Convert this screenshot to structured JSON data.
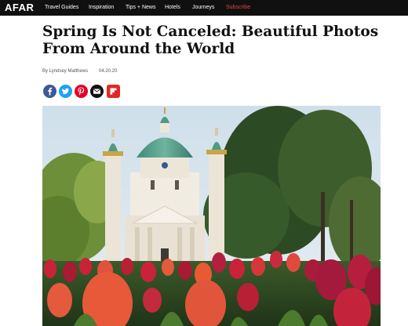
{
  "brand": {
    "logo": "AFAR"
  },
  "nav": {
    "items": [
      "Travel Guides",
      "Inspiration",
      "Tips + News",
      "Hotels",
      "Journeys"
    ],
    "subscribe": "Subscribe",
    "subscribe_color": "#e4473f"
  },
  "article": {
    "headline": "Spring Is Not Canceled: Beautiful Photos From Around the World",
    "byline": "By Lyndsey Matthews",
    "date": "04.20.20"
  },
  "share": {
    "buttons": [
      {
        "icon": "facebook-icon",
        "color": "#3b5998"
      },
      {
        "icon": "twitter-icon",
        "color": "#1da1f2"
      },
      {
        "icon": "pinterest-icon",
        "color": "#e60023"
      },
      {
        "icon": "email-icon",
        "color": "#111111"
      },
      {
        "icon": "flipboard-icon",
        "color": "#e12828"
      }
    ]
  },
  "hero": {
    "subject": "Karlskirche church behind red tulip field"
  }
}
